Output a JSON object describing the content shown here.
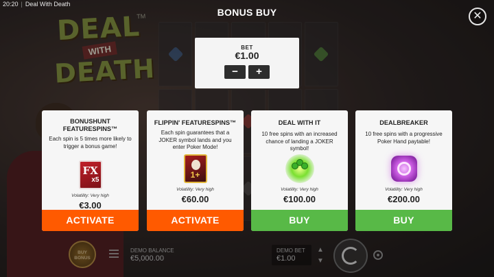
{
  "status_bar": {
    "time": "20:20",
    "game_name": "Deal With Death"
  },
  "logo": {
    "line1": "DEAL",
    "line2": "WITH",
    "line3": "DEATH",
    "tm": "TM"
  },
  "header": {
    "title": "BONUS BUY",
    "close_icon": "close-icon"
  },
  "bet_panel": {
    "label": "BET",
    "value": "€1.00",
    "minus": "−",
    "plus": "+"
  },
  "cards": [
    {
      "name": "BONUSHUNT FEATURESPINS™",
      "description": "Each spin is 5 times more likely to trigger a bonus game!",
      "art": "fx5-symbol",
      "art_text": "FX",
      "art_sub": "x5",
      "volatility": "Volatility: Very high",
      "price": "€3.00",
      "button": "ACTIVATE",
      "button_color": "#ff5a00"
    },
    {
      "name": "FLIPPIN' FEATURESPINS™",
      "description": "Each spin guarantees that a JOKER symbol lands and you enter Poker Mode!",
      "art": "joker-card",
      "art_text": "1+",
      "volatility": "Volatility: Very high",
      "price": "€60.00",
      "button": "ACTIVATE",
      "button_color": "#ff5a00"
    },
    {
      "name": "DEAL WITH IT",
      "description": "10 free spins with an increased chance of landing a JOKER symbol!",
      "art": "green-skulls",
      "volatility": "Volatility: Very high",
      "price": "€100.00",
      "button": "BUY",
      "button_color": "#58b947"
    },
    {
      "name": "DEALBREAKER",
      "description": "10 free spins with a progressive Poker Hand paytable!",
      "art": "purple-token",
      "volatility": "Volatility: Very high",
      "price": "€200.00",
      "button": "BUY",
      "button_color": "#58b947"
    }
  ],
  "bottom_bar": {
    "buy_bonus": "BUY BONUS",
    "balance_label": "DEMO BALANCE",
    "balance_value": "€5,000.00",
    "bet_label": "DEMO BET",
    "bet_value": "€1.00"
  },
  "colors": {
    "activate": "#ff5a00",
    "buy": "#58b947",
    "card_bg": "#f6f6f6"
  }
}
